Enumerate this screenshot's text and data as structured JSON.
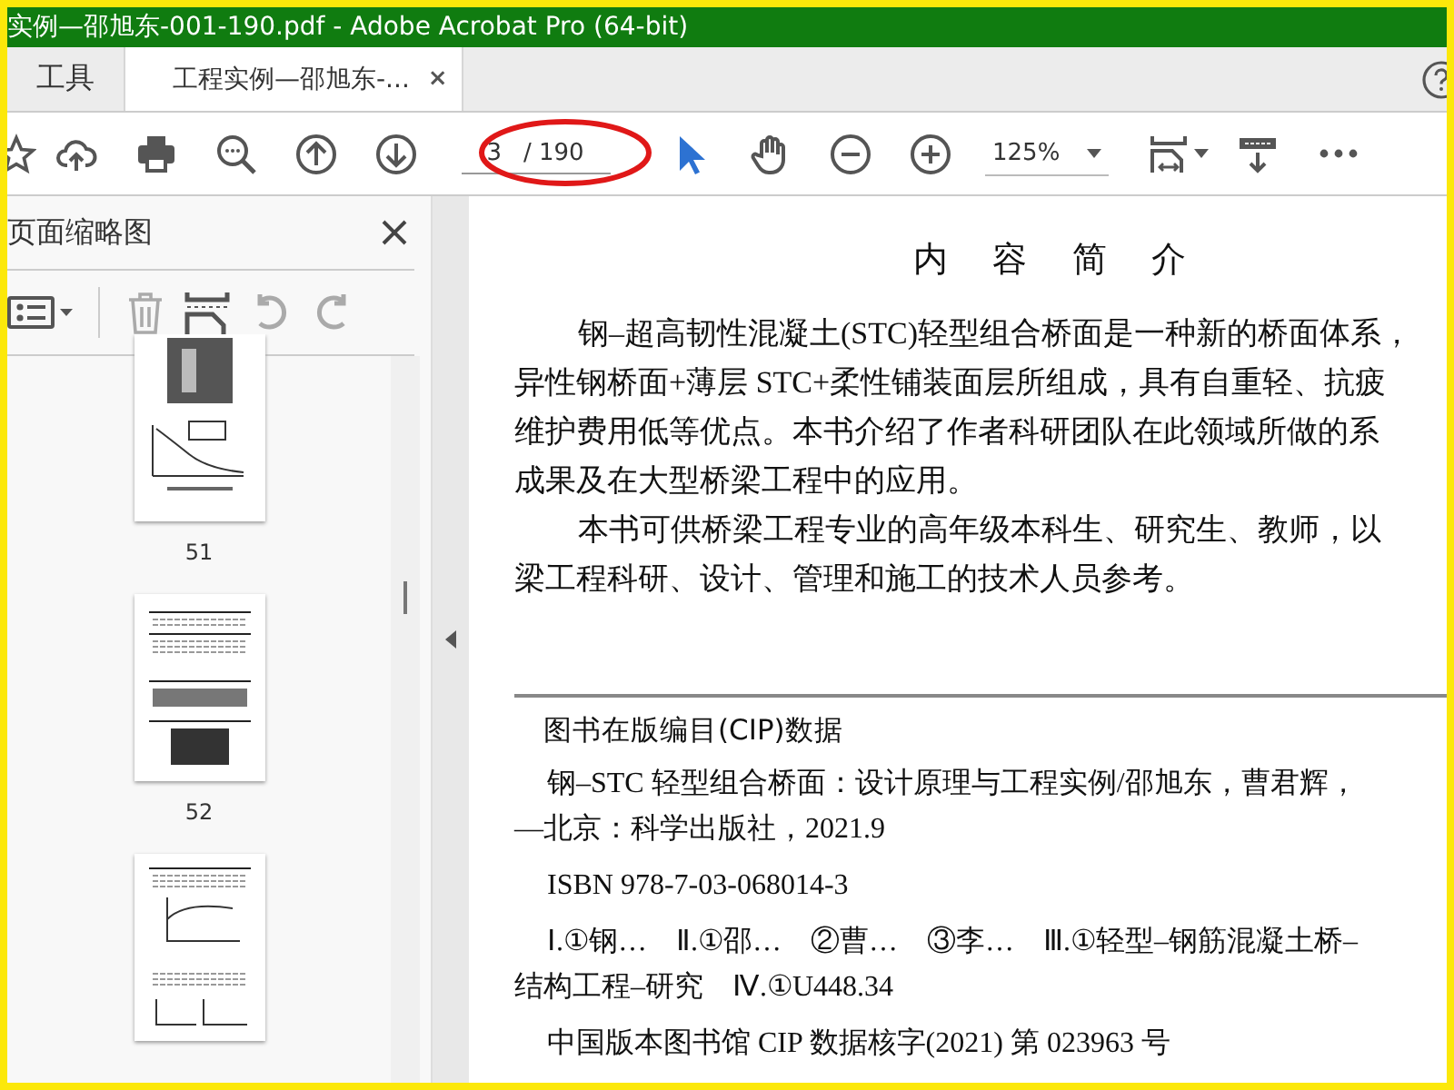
{
  "window": {
    "title": "实例—邵旭东-001-190.pdf - Adobe Acrobat Pro (64-bit)"
  },
  "tabs": [
    {
      "label": "工具",
      "selected": false
    },
    {
      "label": "工程实例—邵旭东-...",
      "selected": true,
      "close": "×"
    }
  ],
  "toolbar": {
    "tools": [
      {
        "kind": "star",
        "selected": false
      },
      {
        "kind": "cloud",
        "selected": false
      },
      {
        "kind": "print",
        "selected": false
      },
      {
        "kind": "zoom-search",
        "selected": false
      },
      {
        "kind": "prev",
        "selected": false
      },
      {
        "kind": "next",
        "selected": false
      },
      {
        "kind": "page",
        "selected": false
      },
      {
        "kind": "select",
        "selected": true
      },
      {
        "kind": "hand",
        "selected": false
      },
      {
        "kind": "zoom-out",
        "selected": false
      },
      {
        "kind": "zoom-in",
        "selected": false
      },
      {
        "kind": "zoom",
        "selected": false
      },
      {
        "kind": "fit",
        "selected": false
      },
      {
        "kind": "read",
        "selected": false
      },
      {
        "kind": "more",
        "selected": false
      }
    ],
    "page_field": {
      "value": "3"
    },
    "page_count": "/ 190",
    "zoom_field": {
      "value": "125%"
    }
  },
  "sidebar": {
    "title": "页面缩略图",
    "thumbnails": [
      {
        "label": "51",
        "kind": "figures"
      },
      {
        "label": "52",
        "kind": "text-figure"
      },
      {
        "kind": "charts"
      }
    ]
  },
  "document": {
    "heading": "内 容 简 介",
    "paragraphs": [
      [
        "钢–超高韧性混凝土(STC)轻型组合桥面是一种新的桥面体系，",
        "异性钢桥面+薄层 STC+柔性铺装面层所组成，具有自重轻、抗疲",
        "维护费用低等优点。本书介绍了作者科研团队在此领域所做的系",
        "成果及在大型桥梁工程中的应用。"
      ],
      [
        "本书可供桥梁工程专业的高年级本科生、研究生、教师，以",
        "梁工程科研、设计、管理和施工的技术人员参考。"
      ]
    ],
    "cip": {
      "heading": "图书在版编目(CIP)数据",
      "entries": [
        [
          "钢–STC 轻型组合桥面：设计原理与工程实例/邵旭东，曹君辉，",
          "—北京：科学出版社，2021.9"
        ],
        [
          "ISBN 978-7-03-068014-3"
        ],
        [
          "Ⅰ.①钢…　Ⅱ.①邵…　②曹…　③李…　Ⅲ.①轻型–钢筋混凝土桥–",
          "结构工程–研究　Ⅳ.①U448.34"
        ],
        [
          "中国版本图书馆 CIP 数据核字(2021) 第 023963 号"
        ]
      ]
    }
  }
}
